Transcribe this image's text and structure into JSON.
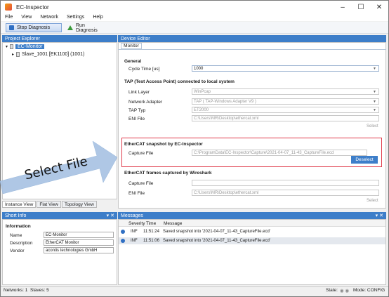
{
  "window": {
    "title": "EC-Inspector",
    "controls": [
      "–",
      "☐",
      "✕"
    ]
  },
  "menu": [
    "File",
    "View",
    "Network",
    "Settings",
    "Help"
  ],
  "toolbar": {
    "stop_label": "Stop Diagnosis",
    "run_label": "Run Diagnosis"
  },
  "project_explorer": {
    "header": "Project Explorer",
    "tree": [
      {
        "label": "EC-Monitor",
        "selected": true
      },
      {
        "label": "Slave_1001 [EK1100] (1001)",
        "selected": false
      }
    ],
    "tabs": [
      "Instance View",
      "Flat View",
      "Topology View"
    ]
  },
  "device_editor": {
    "header": "Device Editor",
    "tab": "Monitor",
    "general": {
      "title": "General",
      "cycle_time_label": "Cycle Time [us]",
      "cycle_time_value": "1000"
    },
    "tap": {
      "title": "TAP (Test Access Point) connected to local system",
      "link_layer_label": "Link Layer",
      "link_layer_value": "WinPcap",
      "network_adapter_label": "Network Adapter",
      "network_adapter_value": "TAP ( TAP-Windows Adapter V9 )",
      "tap_typ_label": "TAP Typ",
      "tap_typ_value": "ET2000",
      "eni_file_label": "ENI File",
      "eni_file_value": "C:\\Users\\MR\\Desktop\\ethercat.xml",
      "select_label": "Select"
    },
    "snapshot": {
      "title": "EtherCAT snapshot by EC-Inspector",
      "capture_file_label": "Capture File",
      "capture_file_value": "C:\\ProgramData\\EC-Inspector\\Capture\\2021-04-07_11-43_CaptureFile.ecd",
      "deselect_label": "Deselect"
    },
    "wireshark": {
      "title": "EtherCAT frames captured by Wireshark",
      "capture_file_label": "Capture File",
      "eni_file_label": "ENI File",
      "eni_file_value": "C:\\Users\\MR\\Desktop\\ethercat.xml",
      "select_label": "Select"
    }
  },
  "annotation": {
    "text": "Select File"
  },
  "short_info": {
    "header": "Short Info",
    "section": "Information",
    "fields": [
      {
        "label": "Name",
        "value": "EC-Monitor"
      },
      {
        "label": "Description",
        "value": "EtherCAT Monitor"
      },
      {
        "label": "Vendor",
        "value": "acontis technologies GmbH"
      }
    ]
  },
  "messages": {
    "header": "Messages",
    "columns": [
      "Severity",
      "Time",
      "Message"
    ],
    "rows": [
      {
        "severity": "INF",
        "time": "11:51:24",
        "message": "Saved snapshot into '2021-04-07_11-43_CaptureFile.ecd'"
      },
      {
        "severity": "INF",
        "time": "11:51:06",
        "message": "Saved snapshot into '2021-04-07_11-43_CaptureFile.ecd'"
      }
    ]
  },
  "status": {
    "networks": "Networks: 1",
    "slaves": "Slaves: 5",
    "state_label": "State:",
    "mode": "Mode: CONFIG"
  },
  "colors": {
    "accent": "#3d7ec9",
    "highlight_border": "#e03a4a",
    "arrow_fill": "#a9c3e3"
  }
}
